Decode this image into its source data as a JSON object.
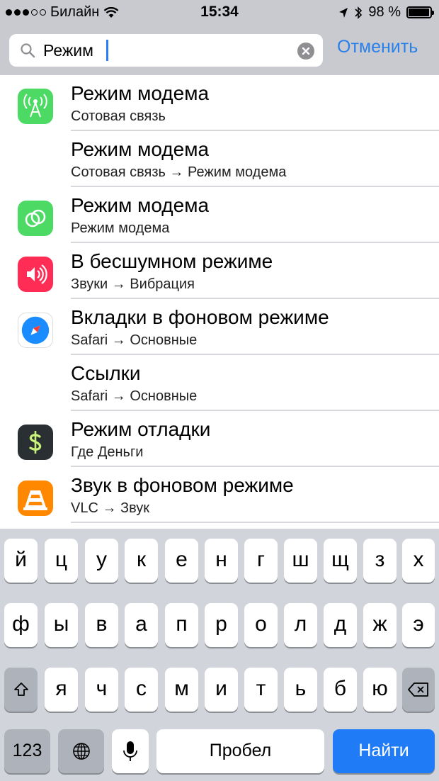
{
  "status_bar": {
    "carrier": "Билайн",
    "time": "15:34",
    "battery_percent": "98 %",
    "battery_level": 0.98
  },
  "search": {
    "query": "Режим",
    "cancel_label": "Отменить"
  },
  "results": [
    {
      "title": "Режим модема",
      "subtitle": "Сотовая связь",
      "icon": "cellular-icon",
      "icon_color": "#4cd964"
    },
    {
      "title": "Режим модема",
      "subtitle": "Сотовая связь → Режим модема",
      "icon": "",
      "icon_color": ""
    },
    {
      "title": "Режим модема",
      "subtitle": "Режим модема",
      "icon": "hotspot-icon",
      "icon_color": "#4cd964"
    },
    {
      "title": "В бесшумном режиме",
      "subtitle": "Звуки → Вибрация",
      "icon": "sounds-icon",
      "icon_color": "#ff2d55"
    },
    {
      "title": "Вкладки в фоновом режиме",
      "subtitle": "Safari → Основные",
      "icon": "safari-icon",
      "icon_color": "#1a8cff"
    },
    {
      "title": "Ссылки",
      "subtitle": "Safari → Основные",
      "icon": "",
      "icon_color": ""
    },
    {
      "title": "Режим отладки",
      "subtitle": "Где Деньги",
      "icon": "dollar-app-icon",
      "icon_color": "#2a2f33"
    },
    {
      "title": "Звук в фоновом режиме",
      "subtitle": "VLC → Звук",
      "icon": "vlc-icon",
      "icon_color": "#ff8800"
    }
  ],
  "keyboard": {
    "row1": [
      "й",
      "ц",
      "у",
      "к",
      "е",
      "н",
      "г",
      "ш",
      "щ",
      "з",
      "х"
    ],
    "row2": [
      "ф",
      "ы",
      "в",
      "а",
      "п",
      "р",
      "о",
      "л",
      "д",
      "ж",
      "э"
    ],
    "row3": [
      "я",
      "ч",
      "с",
      "м",
      "и",
      "т",
      "ь",
      "б",
      "ю"
    ],
    "numbers_label": "123",
    "space_label": "Пробел",
    "search_label": "Найти"
  }
}
